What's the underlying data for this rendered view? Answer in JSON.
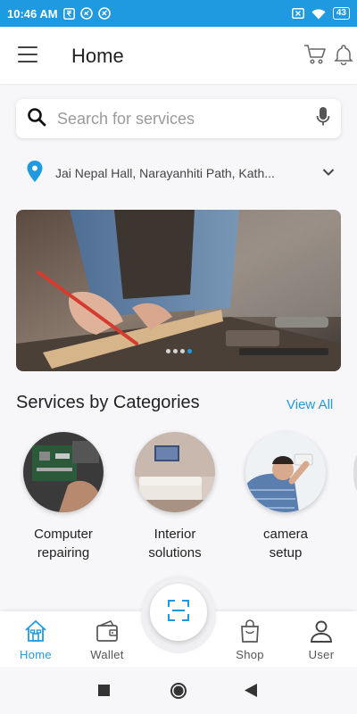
{
  "status": {
    "time": "10:46 AM",
    "battery": "43"
  },
  "header": {
    "title": "Home"
  },
  "search": {
    "placeholder": "Search for services",
    "value": ""
  },
  "location": {
    "text": "Jai Nepal Hall, Narayanhiti Path, Kath..."
  },
  "banner": {
    "slide_count": 4,
    "active_slide": 4
  },
  "categories": {
    "title": "Services by Categories",
    "view_all": "View All",
    "items": [
      {
        "line1": "Computer",
        "line2": "repairing"
      },
      {
        "line1": "Interior",
        "line2": "solutions"
      },
      {
        "line1": "camera",
        "line2": "setup"
      }
    ]
  },
  "bottom_nav": {
    "items": [
      {
        "label": "Home",
        "icon": "home-icon"
      },
      {
        "label": "Wallet",
        "icon": "wallet-icon"
      },
      {
        "label": "Shop",
        "icon": "shopping-bag-icon"
      },
      {
        "label": "User",
        "icon": "user-icon"
      }
    ],
    "center_icon": "scan-icon"
  },
  "colors": {
    "accent": "#1f9ae0",
    "status_bar": "#1f9ae0"
  }
}
